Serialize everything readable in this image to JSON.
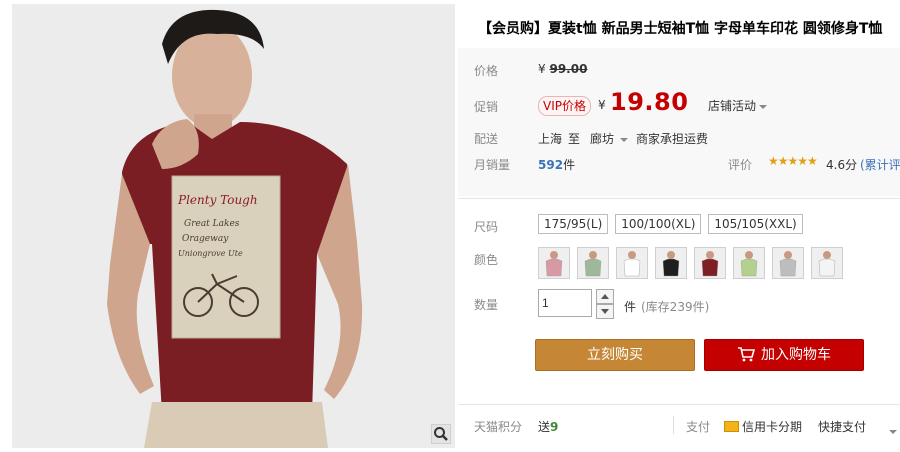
{
  "product": {
    "title": "【会员购】夏装t恤 新品男士短袖T恤 字母单车印花 圆领修身T恤",
    "image_shirt_text": [
      "Plenty Tough",
      "Great Lakes",
      "Orageway",
      "Uniongrove Ute"
    ]
  },
  "price": {
    "label": "价格",
    "currency": "¥",
    "original": "99.00"
  },
  "promo": {
    "label": "促销",
    "vip_badge": "VIP价格",
    "currency": "¥",
    "price": "19.80",
    "store_activity": "店铺活动"
  },
  "delivery": {
    "label": "配送",
    "from": "上海",
    "to_word": "至",
    "to": "廊坊",
    "fee_note": "商家承担运费"
  },
  "sales": {
    "label": "月销量",
    "count": "592",
    "unit": "件",
    "rating_label": "评价",
    "score": "4.6分",
    "review_link": "(累计评价"
  },
  "sizes": {
    "label": "尺码",
    "options": [
      "175/95(L)",
      "100/100(XL)",
      "105/105(XXL)"
    ]
  },
  "colors": {
    "label": "颜色",
    "swatches": [
      {
        "name": "pink",
        "shirt": "#d79aa4"
      },
      {
        "name": "green-grey",
        "shirt": "#9fb89a"
      },
      {
        "name": "white",
        "shirt": "#ffffff"
      },
      {
        "name": "black",
        "shirt": "#1e1e1e"
      },
      {
        "name": "burgundy",
        "shirt": "#7d1f24"
      },
      {
        "name": "light-green",
        "shirt": "#b4d08f"
      },
      {
        "name": "grey",
        "shirt": "#bdbdbd"
      },
      {
        "name": "white-2",
        "shirt": "#f4f4f4"
      }
    ]
  },
  "quantity": {
    "label": "数量",
    "value": "1",
    "unit": "件",
    "stock": "(库存239件)"
  },
  "actions": {
    "buy_now": "立刻购买",
    "add_cart": "加入购物车"
  },
  "bottom": {
    "points_label": "天猫积分",
    "points_prefix": "送",
    "points_value": "9",
    "pay_label": "支付",
    "credit": "信用卡分期",
    "quick_pay": "快捷支付"
  },
  "colors_theme": {
    "accent_red": "#c40000",
    "buy_orange": "#c58736",
    "link_blue": "#3a73b8"
  }
}
